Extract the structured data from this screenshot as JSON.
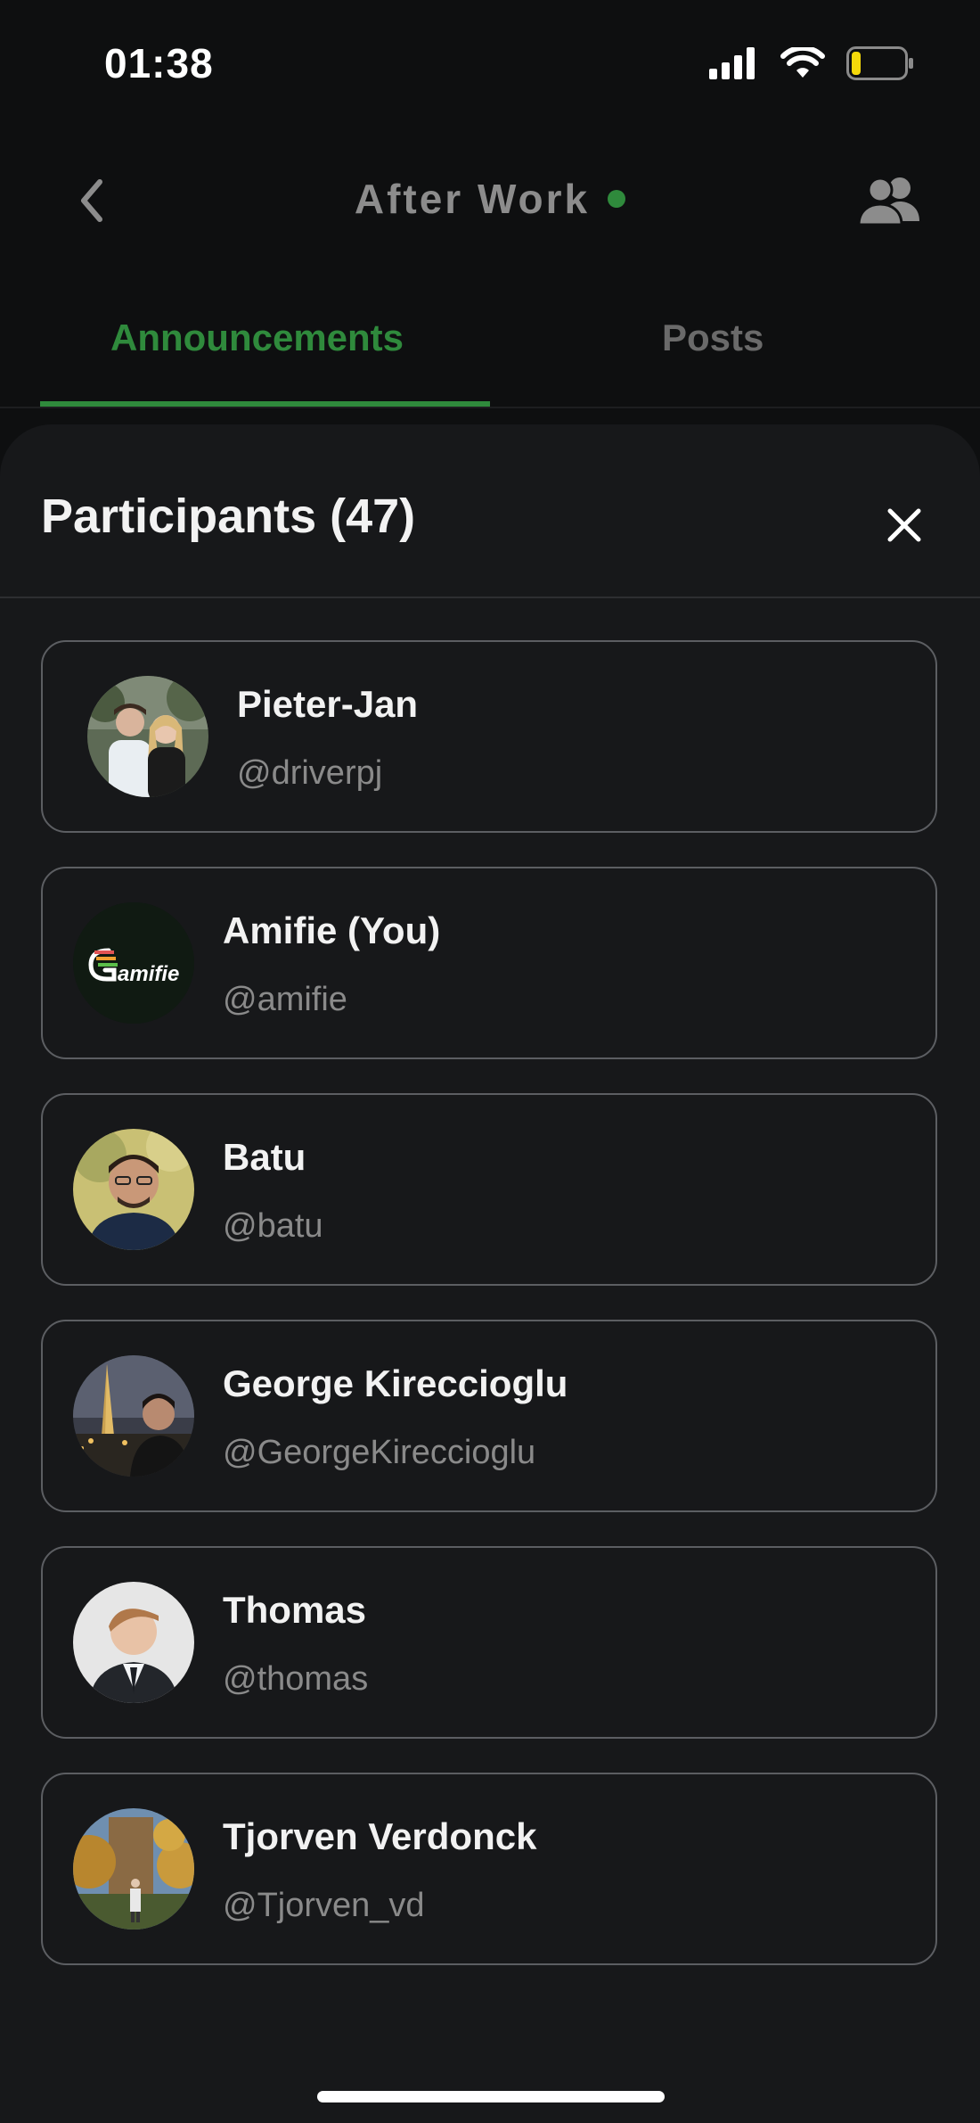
{
  "status_bar": {
    "time": "01:38",
    "icons": [
      "signal-icon",
      "wifi-icon",
      "battery-icon"
    ]
  },
  "header": {
    "title": "After Work",
    "online_color": "#2f8a3c"
  },
  "tabs": [
    {
      "label": "Announcements",
      "active": true
    },
    {
      "label": "Posts",
      "active": false
    }
  ],
  "sheet": {
    "title": "Participants (47)"
  },
  "participants": [
    {
      "name": "Pieter-Jan",
      "handle": "@driverpj"
    },
    {
      "name": "Amifie (You)",
      "handle": "@amifie",
      "logo_text": "amifie"
    },
    {
      "name": "Batu",
      "handle": "@batu"
    },
    {
      "name": "George Kireccioglu",
      "handle": "@GeorgeKireccioglu"
    },
    {
      "name": "Thomas",
      "handle": "@thomas"
    },
    {
      "name": "Tjorven Verdonck",
      "handle": "@Tjorven_vd"
    }
  ],
  "colors": {
    "accent": "#2f8a3c",
    "background": "#0e0f10",
    "sheet": "#17181a"
  }
}
